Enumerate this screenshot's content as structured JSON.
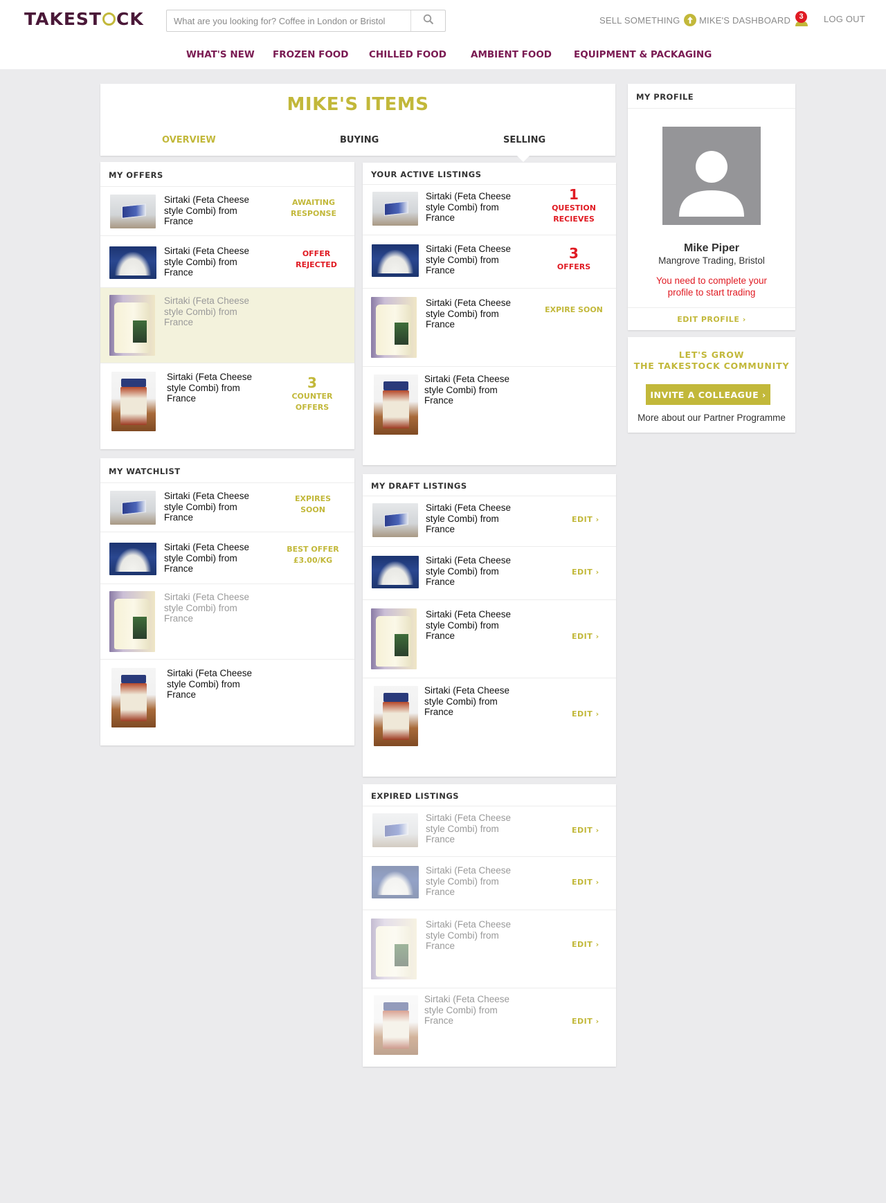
{
  "header": {
    "logo": "TAKESTOCK",
    "search_placeholder": "What are you looking for? Coffee in London or Bristol",
    "sell_label": "SELL SOMETHING",
    "dashboard_label": "MIKE'S DASHBOARD",
    "notification_count": "3",
    "logout_label": "LOG OUT"
  },
  "categories": [
    "WHAT'S NEW",
    "FROZEN FOOD",
    "CHILLED FOOD",
    "AMBIENT FOOD",
    "EQUIPMENT & PACKAGING"
  ],
  "page": {
    "title": "MIKE'S ITEMS",
    "tabs": [
      "OVERVIEW",
      "BUYING",
      "SELLING"
    ],
    "active_tab": "SELLING"
  },
  "offers": {
    "title": "MY OFFERS",
    "items": [
      {
        "name": "Sirtaki (Feta Cheese style Combi) from France",
        "image": "blue-box",
        "status": "AWAITING RESPONSE"
      },
      {
        "name": "Sirtaki (Feta Cheese style Combi) from France",
        "image": "flour-pile",
        "status": "OFFER REJECTED"
      },
      {
        "name": "Sirtaki (Feta Cheese style Combi) from France",
        "image": "plastic-jug",
        "status": ""
      },
      {
        "name": "Sirtaki (Feta Cheese style Combi) from France",
        "image": "jar",
        "count": "3",
        "status": "COUNTER OFFERS"
      }
    ]
  },
  "watchlist": {
    "title": "MY WATCHLIST",
    "items": [
      {
        "name": "Sirtaki (Feta Cheese style Combi) from France",
        "image": "blue-box",
        "status": "EXPIRES SOON"
      },
      {
        "name": "Sirtaki (Feta Cheese style Combi) from France",
        "image": "flour-pile",
        "status": "BEST OFFER £3.00/KG"
      },
      {
        "name": "Sirtaki (Feta Cheese style Combi) from France",
        "image": "plastic-jug",
        "status": ""
      },
      {
        "name": "Sirtaki (Feta Cheese style Combi) from France",
        "image": "jar",
        "status": ""
      }
    ]
  },
  "active_listings": {
    "title": "YOUR ACTIVE LISTINGS",
    "items": [
      {
        "name": "Sirtaki (Feta Cheese style Combi) from France",
        "image": "blue-box",
        "count": "1",
        "status": "QUESTION RECIEVES"
      },
      {
        "name": "Sirtaki (Feta Cheese style Combi) from France",
        "image": "flour-pile",
        "count": "3",
        "status": "OFFERS"
      },
      {
        "name": "Sirtaki (Feta Cheese style Combi) from France",
        "image": "plastic-jug",
        "status": "EXPIRE SOON"
      },
      {
        "name": "Sirtaki (Feta Cheese style Combi) from France",
        "image": "jar",
        "status": ""
      }
    ]
  },
  "draft_listings": {
    "title": "MY DRAFT LISTINGS",
    "edit_label": "EDIT",
    "items": [
      {
        "name": "Sirtaki (Feta Cheese style Combi) from France",
        "image": "blue-box"
      },
      {
        "name": "Sirtaki (Feta Cheese style Combi) from France",
        "image": "flour-pile"
      },
      {
        "name": "Sirtaki (Feta Cheese style Combi) from France",
        "image": "plastic-jug"
      },
      {
        "name": "Sirtaki (Feta Cheese style Combi) from France",
        "image": "jar"
      }
    ]
  },
  "expired_listings": {
    "title": "EXPIRED LISTINGS",
    "edit_label": "EDIT",
    "items": [
      {
        "name": "Sirtaki (Feta Cheese style Combi) from France",
        "image": "blue-box"
      },
      {
        "name": "Sirtaki (Feta Cheese style Combi) from France",
        "image": "flour-pile"
      },
      {
        "name": "Sirtaki (Feta Cheese style Combi) from France",
        "image": "plastic-jug"
      },
      {
        "name": "Sirtaki (Feta Cheese style Combi) from France",
        "image": "jar"
      }
    ]
  },
  "profile": {
    "title": "MY PROFILE",
    "name": "Mike Piper",
    "company": "Mangrove Trading, Bristol",
    "warning": "You need to complete your profile to start trading",
    "edit_label": "EDIT PROFILE"
  },
  "community": {
    "title_line1": "LET'S GROW",
    "title_line2": "THE TAKESTOCK COMMUNITY",
    "button_label": "INVITE A COLLEAGUE",
    "link_text": "More about our Partner Programme"
  },
  "colors": {
    "accent": "#c2b83a",
    "brand": "#4a1838",
    "nav": "#7a1a52",
    "alert": "#e01b23",
    "background": "#ebebed"
  }
}
